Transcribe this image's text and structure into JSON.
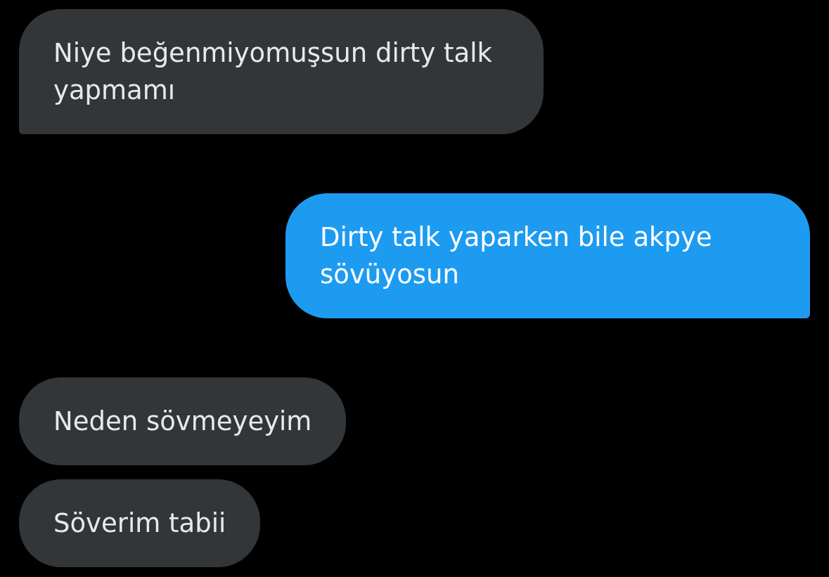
{
  "messages": [
    {
      "kind": "received",
      "text": "Niye beğenmiyomuşsun dirty talk yapmamı",
      "tail": true
    },
    {
      "kind": "sent",
      "text": "Dirty talk yaparken bile akpye sövüyosun",
      "tail": true
    },
    {
      "kind": "received",
      "text": "Neden sövmeyeyim",
      "tail": false
    },
    {
      "kind": "received",
      "text": "Söverim tabii",
      "tail": false
    }
  ]
}
